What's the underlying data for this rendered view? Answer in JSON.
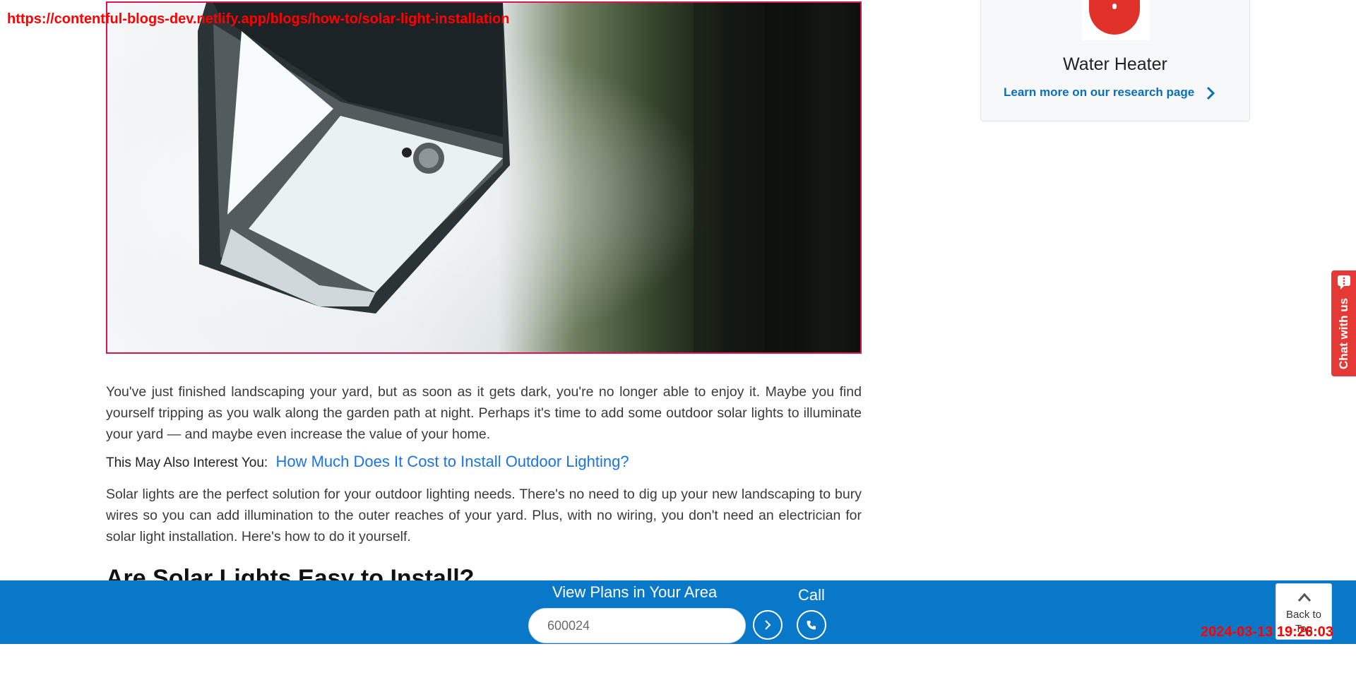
{
  "overlay": {
    "url": "https://contentful-blogs-dev.netlify.app/blogs/how-to/solar-light-installation",
    "timestamp": "2024-03-13 19:26:03"
  },
  "hero": {
    "alt_icon": "solar-wall-light-image"
  },
  "article": {
    "para1": "You've just finished landscaping your yard, but as soon as it gets dark, you're no longer able to enjoy it. Maybe you find yourself tripping as you walk along the garden path at night. Perhaps it's time to add some outdoor solar lights to illuminate your yard — and maybe even increase the value of your home.",
    "interest_label": "This May Also Interest You:",
    "interest_link": "How Much Does It Cost to Install Outdoor Lighting?",
    "para2": "Solar lights are the perfect solution for your outdoor lighting needs. There's no need to dig up your new landscaping to bury wires so you can add illumination to the outer reaches of your yard. Plus, with no wiring, you don't need an electrician for solar light installation. Here's how to do it yourself.",
    "heading": "Are Solar Lights Easy to Install?"
  },
  "sidebar": {
    "card_title": "Water Heater",
    "card_link": "Learn more on our research page",
    "icon": "water-heater-icon"
  },
  "chat": {
    "label": "Chat with us"
  },
  "bottom_bar": {
    "title": "View Plans in Your Area",
    "zip_value": "600024",
    "call_label": "Call",
    "back_to_top": "Back to Top"
  },
  "colors": {
    "bar": "#0a78c9",
    "link": "#1a73e8",
    "accent_red": "#e53935",
    "hero_border": "#d8174f"
  }
}
